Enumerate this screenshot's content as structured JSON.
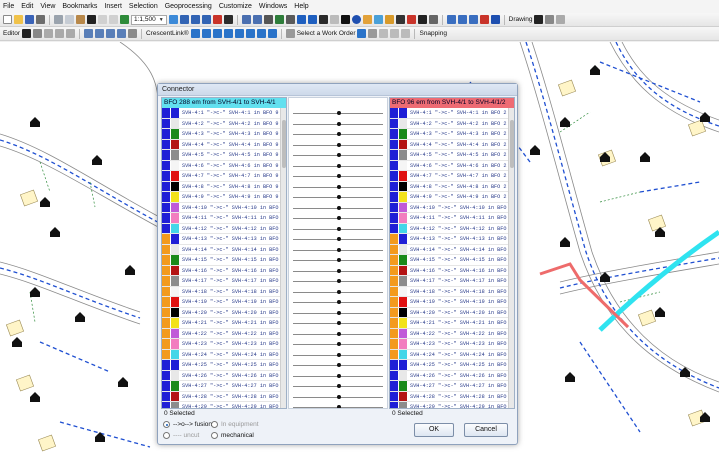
{
  "menu": [
    "File",
    "Edit",
    "View",
    "Bookmarks",
    "Insert",
    "Selection",
    "Geoprocessing",
    "Customize",
    "Windows",
    "Help"
  ],
  "toolbar1": {
    "scale": "1:1,500",
    "drawing_label": "Drawing"
  },
  "toolbar2": {
    "editor_label": "Editor",
    "feature_template": "CrescentLink®",
    "work_order_button": "Select a Work Order",
    "snapping_label": "Snapping"
  },
  "dialog": {
    "title": "Connector",
    "left": {
      "header": "BFO 288 em from SVH-4/1 to SVH-4/1",
      "selected": "0 Selected",
      "rows": [
        "SVH-4:1  \"->c-\"  SVH-4:1 in BFO 9",
        "SVH-4:2  \"->c-\"  SVH-4:2 in BFO 9",
        "SVH-4:3  \"->c-\"  SVH-4:3 in BFO 9",
        "SVH-4:4  \"->c-\"  SVH-4:4 in BFO 9",
        "SVH-4:5  \"->c-\"  SVH-4:5 in BFO 9",
        "SVH-4:6  \"->c-\"  SVH-4:6 in BFO 9",
        "SVH-4:7  \"->c-\"  SVH-4:7 in BFO 9",
        "SVH-4:8  \"->c-\"  SVH-4:8 in BFO 9",
        "SVH-4:9  \"->c-\"  SVH-4:9 in BFO 9",
        "SVH-4:10 \"->c-\"  SVH-4:10 in BFO",
        "SVH-4:11 \"->c-\"  SVH-4:11 in BFO",
        "SVH-4:12 \"->c-\"  SVH-4:12 in BFO",
        "SVH-4:13 \"->c-\"  SVH-4:13 in BFO",
        "SVH-4:14 \"->c-\"  SVH-4:14 in BFO",
        "SVH-4:15 \"->c-\"  SVH-4:15 in BFO",
        "SVH-4:16 \"->c-\"  SVH-4:16 in BFO",
        "SVH-4:17 \"->c-\"  SVH-4:17 in BFO",
        "SVH-4:18 \"->c-\"  SVH-4:18 in BFO",
        "SVH-4:19 \"->c-\"  SVH-4:19 in BFO",
        "SVH-4:20 \"->c-\"  SVH-4:20 in BFO",
        "SVH-4:21 \"->c-\"  SVH-4:21 in BFO",
        "SVH-4:22 \"->c-\"  SVH-4:22 in BFO",
        "SVH-4:23 \"->c-\"  SVH-4:23 in BFO",
        "SVH-4:24 \"->c-\"  SVH-4:24 in BFO",
        "SVH-4:25 \"->c-\"  SVH-4:25 in BFO",
        "SVH-4:26 \"->c-\"  SVH-4:26 in BFO",
        "SVH-4:27 \"->c-\"  SVH-4:27 in BFO",
        "SVH-4:28 \"->c-\"  SVH-4:28 in BFO",
        "SVH-4:29 \"->c-\"  SVH-4:29 in BFO"
      ]
    },
    "right": {
      "header": "BFO 96 em from SVH-4/1 to SVH-4/1/2",
      "selected": "0 Selected",
      "rows": [
        "SVH-4:1  \"->c-\"  SVH-4:1 in BFO 2",
        "SVH-4:2  \"->c-\"  SVH-4:2 in BFO 2",
        "SVH-4:3  \"->c-\"  SVH-4:3 in BFO 2",
        "SVH-4:4  \"->c-\"  SVH-4:4 in BFO 2",
        "SVH-4:5  \"->c-\"  SVH-4:5 in BFO 2",
        "SVH-4:6  \"->c-\"  SVH-4:6 in BFO 2",
        "SVH-4:7  \"->c-\"  SVH-4:7 in BFO 2",
        "SVH-4:8  \"->c-\"  SVH-4:8 in BFO 2",
        "SVH-4:9  \"->c-\"  SVH-4:9 in BFO 2",
        "SVH-4:10 \"->c-\"  SVH-4:10 in BFO",
        "SVH-4:11 \"->c-\"  SVH-4:11 in BFO",
        "SVH-4:12 \"->c-\"  SVH-4:12 in BFO",
        "SVH-4:13 \"->c-\"  SVH-4:13 in BFO",
        "SVH-4:14 \"->c-\"  SVH-4:14 in BFO",
        "SVH-4:15 \"->c-\"  SVH-4:15 in BFO",
        "SVH-4:16 \"->c-\"  SVH-4:16 in BFO",
        "SVH-4:17 \"->c-\"  SVH-4:17 in BFO",
        "SVH-4:18 \"->c-\"  SVH-4:18 in BFO",
        "SVH-4:19 \"->c-\"  SVH-4:19 in BFO",
        "SVH-4:20 \"->c-\"  SVH-4:20 in BFO",
        "SVH-4:21 \"->c-\"  SVH-4:21 in BFO",
        "SVH-4:22 \"->c-\"  SVH-4:22 in BFO",
        "SVH-4:23 \"->c-\"  SVH-4:23 in BFO",
        "SVH-4:24 \"->c-\"  SVH-4:24 in BFO",
        "SVH-4:25 \"->c-\"  SVH-4:25 in BFO",
        "SVH-4:26 \"->c-\"  SVH-4:26 in BFO",
        "SVH-4:27 \"->c-\"  SVH-4:27 in BFO",
        "SVH-4:28 \"->c-\"  SVH-4:28 in BFO",
        "SVH-4:29 \"->c-\"  SVH-4:29 in BFO"
      ]
    },
    "fiber_colors": [
      "#1f1fd6",
      "#e8e8e8",
      "#1a8a1a",
      "#b41414",
      "#8c8c8c",
      "#f5f5f5",
      "#e01010",
      "#000000",
      "#f2e21a",
      "#c05ad8",
      "#f27dbf",
      "#43d6e8"
    ],
    "tube_colors": [
      "#1f1fd6",
      "#f39a1d"
    ],
    "fibers_per_tube": 12,
    "options": {
      "fusion": "-->o--> fusion",
      "equipment": "In equipment",
      "uncut": "---- uncut",
      "mechanical": "mechanical",
      "selected_option": "fusion"
    },
    "ok_label": "OK",
    "cancel_label": "Cancel"
  }
}
